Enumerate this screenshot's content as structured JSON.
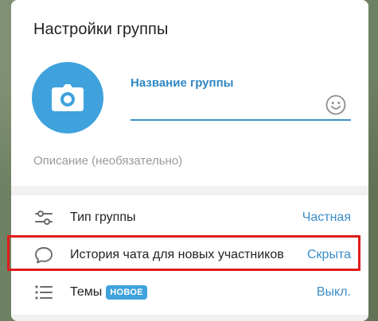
{
  "dialog": {
    "title": "Настройки группы",
    "name_label": "Название группы",
    "name_value": "",
    "description_placeholder": "Описание (необязательно)"
  },
  "rows": [
    {
      "label": "Тип группы",
      "value": "Частная",
      "icon": "sliders-icon"
    },
    {
      "label": "История чата для новых участников",
      "value": "Скрыта",
      "icon": "chat-bubble-icon"
    },
    {
      "label": "Темы",
      "badge": "НОВОЕ",
      "value": "Выкл.",
      "icon": "list-icon"
    }
  ],
  "icons": {
    "avatar": "camera-icon",
    "emoji": "smile-icon"
  },
  "colors": {
    "accent": "#3fa2dd",
    "link": "#3a8cc6",
    "highlight_border": "#e11b1b"
  }
}
